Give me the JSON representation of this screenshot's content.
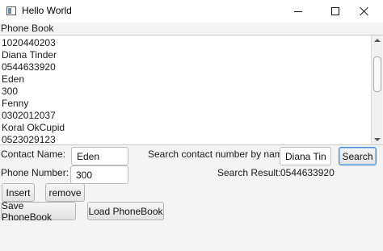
{
  "window": {
    "title": "Hello World",
    "icon": "app-window-icon"
  },
  "panel": {
    "label": "Phone Book"
  },
  "list": {
    "lines": [
      "1020440203",
      "Diana Tinder",
      "0544633920",
      "Eden",
      "300",
      "Fenny",
      "0302012037",
      "Koral OkCupid",
      "0523029123"
    ]
  },
  "form": {
    "contact_name_label": "Contact Name:",
    "contact_name_value": "Eden",
    "phone_number_label": "Phone Number:",
    "phone_number_value": "300",
    "search_label": "Search contact number by name:",
    "search_value": "Diana Tind",
    "search_button": "Search",
    "result_label": "Search Result:",
    "result_value": "0544633920"
  },
  "buttons": {
    "insert": "Insert",
    "remove": "remove",
    "save": "Save PhoneBook",
    "load": "Load PhoneBook"
  }
}
